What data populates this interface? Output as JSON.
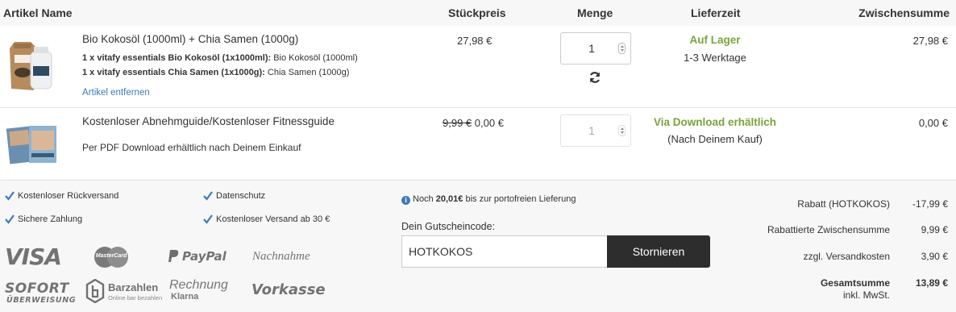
{
  "table_header": {
    "product": "Artikel Name",
    "unit_price": "Stückpreis",
    "quantity": "Menge",
    "delivery": "Lieferzeit",
    "subtotal": "Zwischensumme"
  },
  "items": [
    {
      "name": "Bio Kokosöl (1000ml) + Chia Samen (1000g)",
      "details": [
        {
          "bold": "1 x vitafy essentials Bio Kokosöl (1x1000ml):",
          "text": "Bio Kokosöl (1000ml)"
        },
        {
          "bold": "1 x vitafy essentials Chia Samen (1x1000g):",
          "text": "Chia Samen (1000g)"
        }
      ],
      "remove_label": "Artikel entfernen",
      "unit_price": "27,98 €",
      "quantity": "1",
      "availability": "Auf Lager",
      "delivery_time": "1-3 Werktage",
      "subtotal": "27,98 €"
    },
    {
      "name": "Kostenloser Abnehmguide/Kostenloser Fitnessguide",
      "note": "Per PDF Download erhältlich nach Deinem Einkauf",
      "old_price": "9,99 €",
      "unit_price": "0,00 €",
      "quantity": "1",
      "availability": "Via Download erhältlich",
      "delivery_time": "(Nach Deinem Kauf)",
      "subtotal": "0,00 €"
    }
  ],
  "features": {
    "free_return": "Kostenloser Rückversand",
    "privacy": "Datenschutz",
    "secure_payment": "Sichere Zahlung",
    "free_shipping": "Kostenloser Versand ab 30 €"
  },
  "payment_methods": {
    "visa": "VISA",
    "mastercard": "MasterCard",
    "paypal": "PayPal",
    "cod": "Nachnahme",
    "sofort_top": "SOFORT",
    "sofort_bottom": "ÜBERWEISUNG",
    "barzahlen": "Barzahlen",
    "barzahlen_sub": "Online bar bezahlen",
    "invoice": "Rechnung",
    "klarna": "Klarna",
    "prepayment": "Vorkasse"
  },
  "shipping_info": {
    "prefix": "Noch",
    "amount": "20,01€",
    "suffix": "bis zur portofreien Lieferung"
  },
  "voucher": {
    "label": "Dein Gutscheincode:",
    "value": "HOTKOKOS",
    "button": "Stornieren"
  },
  "summary": {
    "discount_label": "Rabatt (HOTKOKOS)",
    "discount_value": "-17,99 €",
    "discounted_subtotal_label": "Rabattierte Zwischensumme",
    "discounted_subtotal_value": "9,99 €",
    "shipping_label": "zzgl. Versandkosten",
    "shipping_value": "3,90 €",
    "total_label": "Gesamtsumme",
    "total_value": "13,89 €",
    "vat_note": "inkl. MwSt."
  },
  "colors": {
    "accent_green": "#7aa33b",
    "link_blue": "#3d7ab8",
    "button_dark": "#2d2d2d",
    "footer_bg": "#f7f7f7"
  }
}
